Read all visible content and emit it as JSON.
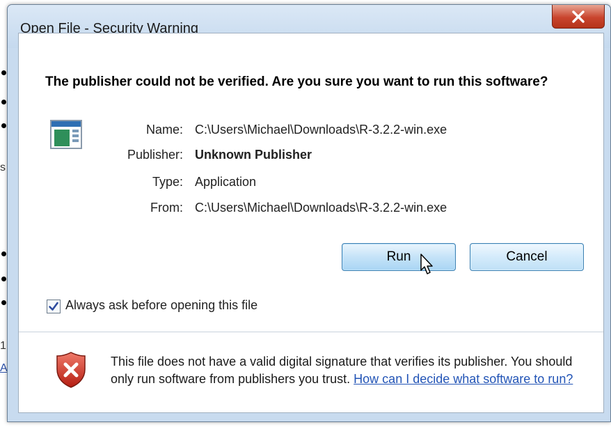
{
  "window": {
    "title": "Open File - Security Warning"
  },
  "background": {
    "fragment_1": "s",
    "fragment_2": "1",
    "link_fragment": "A"
  },
  "dialog": {
    "headline": "The publisher could not be verified.  Are you sure you want to run this software?",
    "fields": [
      {
        "label": "Name:",
        "value": "C:\\Users\\Michael\\Downloads\\R-3.2.2-win.exe"
      },
      {
        "label": "Publisher:",
        "value": "Unknown Publisher"
      },
      {
        "label": "Type:",
        "value": "Application"
      },
      {
        "label": "From:",
        "value": "C:\\Users\\Michael\\Downloads\\R-3.2.2-win.exe"
      }
    ],
    "run_label": "Run",
    "cancel_label": "Cancel",
    "always_ask_label": "Always ask before opening this file",
    "always_ask_checked": true,
    "warning_text": "This file does not have a valid digital signature that verifies its publisher. You should only run software from publishers you trust.",
    "warning_link": "How can I decide what software to run?"
  },
  "icons": {
    "close": "close-icon",
    "application": "application-icon",
    "shield": "shield-error-icon",
    "cursor": "mouse-cursor-icon",
    "checkmark": "checkmark-icon"
  },
  "colors": {
    "close_button": "#c9452e",
    "link": "#2254b6",
    "button_border": "#3c7fb1"
  }
}
